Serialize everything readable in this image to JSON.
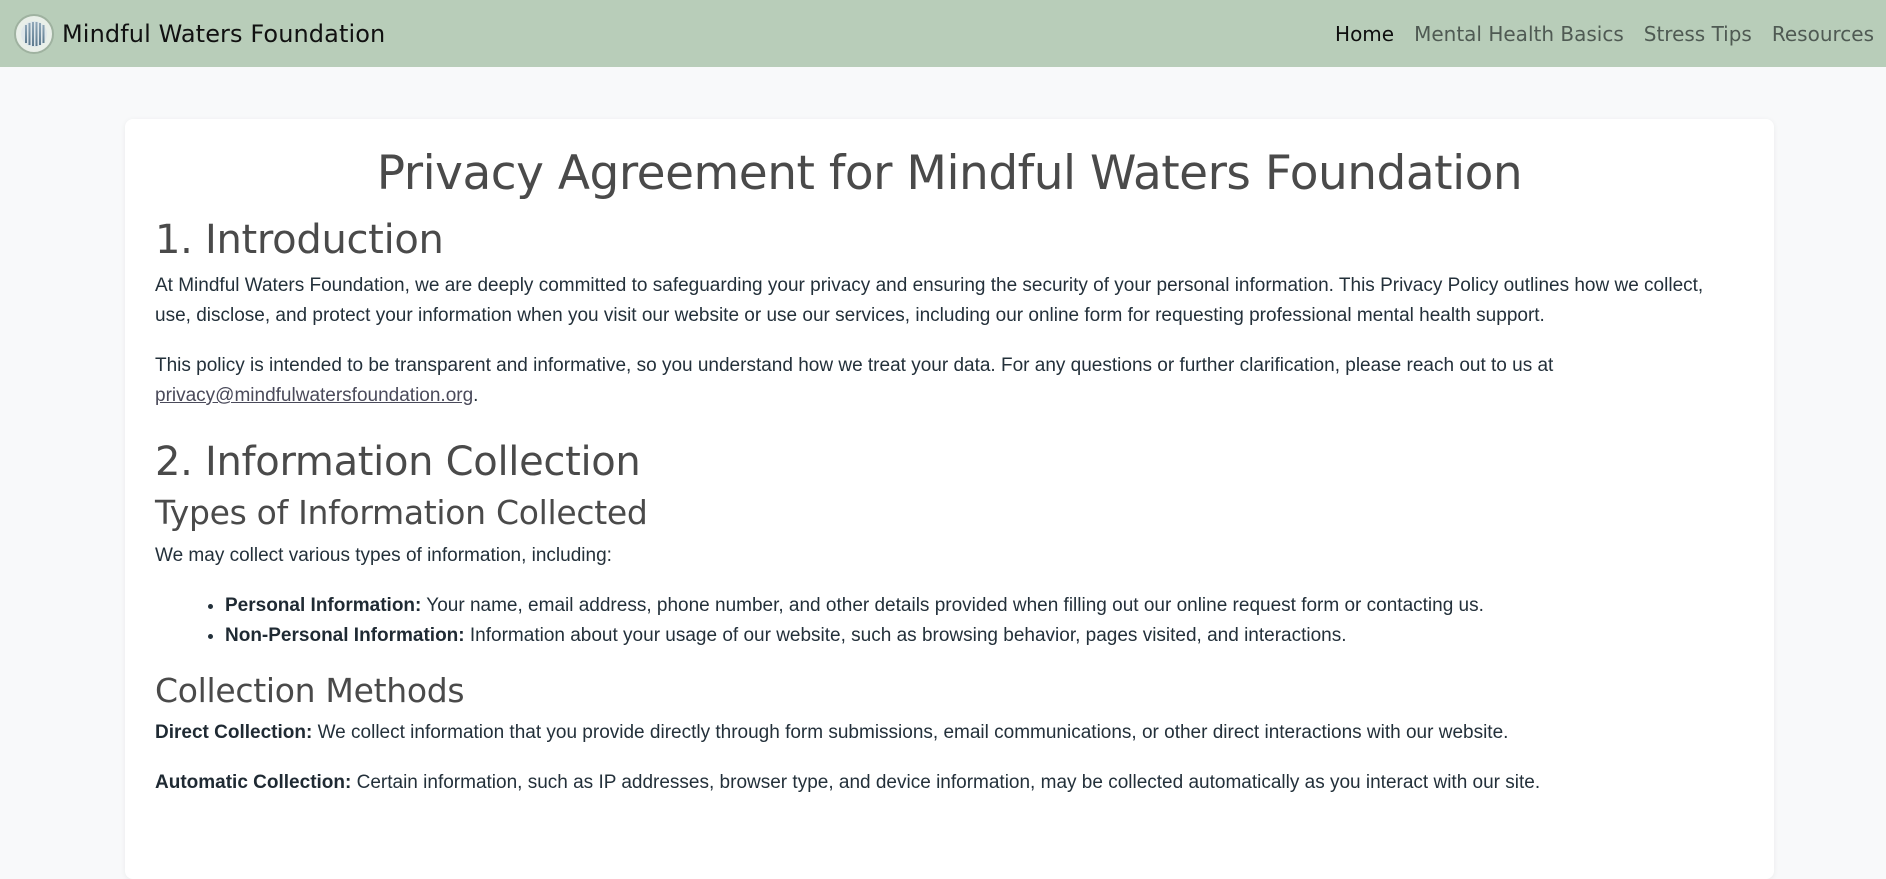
{
  "header": {
    "brand_name": "Mindful Waters Foundation",
    "logo_icon": "water-drops-logo-icon",
    "nav": [
      {
        "label": "Home",
        "active": true
      },
      {
        "label": "Mental Health Basics",
        "active": false
      },
      {
        "label": "Stress Tips",
        "active": false
      },
      {
        "label": "Resources",
        "active": false
      }
    ],
    "background_color": "#b8cdb9"
  },
  "page": {
    "title": "Privacy Agreement for Mindful Waters Foundation",
    "sections": {
      "introduction": {
        "heading": "1. Introduction",
        "paragraph_1": "At Mindful Waters Foundation, we are deeply committed to safeguarding your privacy and ensuring the security of your personal information. This Privacy Policy outlines how we collect, use, disclose, and protect your information when you visit our website or use our services, including our online form for requesting professional mental health support.",
        "paragraph_2_prefix": "This policy is intended to be transparent and informative, so you understand how we treat your data. For any questions or further clarification, please reach out to us at ",
        "contact_email": "privacy@mindfulwatersfoundation.org",
        "paragraph_2_suffix": "."
      },
      "information_collection": {
        "heading": "2. Information Collection",
        "types": {
          "heading": "Types of Information Collected",
          "intro": "We may collect various types of information, including:",
          "items": [
            {
              "term": "Personal Information:",
              "text": " Your name, email address, phone number, and other details provided when filling out our online request form or contacting us."
            },
            {
              "term": "Non-Personal Information:",
              "text": " Information about your usage of our website, such as browsing behavior, pages visited, and interactions."
            }
          ]
        },
        "methods": {
          "heading": "Collection Methods",
          "direct_term": "Direct Collection:",
          "direct_text": " We collect information that you provide directly through form submissions, email communications, or other direct interactions with our website.",
          "automatic_term": "Automatic Collection:",
          "automatic_text": " Certain information, such as IP addresses, browser type, and device information, may be collected automatically as you interact with our site."
        }
      }
    }
  }
}
